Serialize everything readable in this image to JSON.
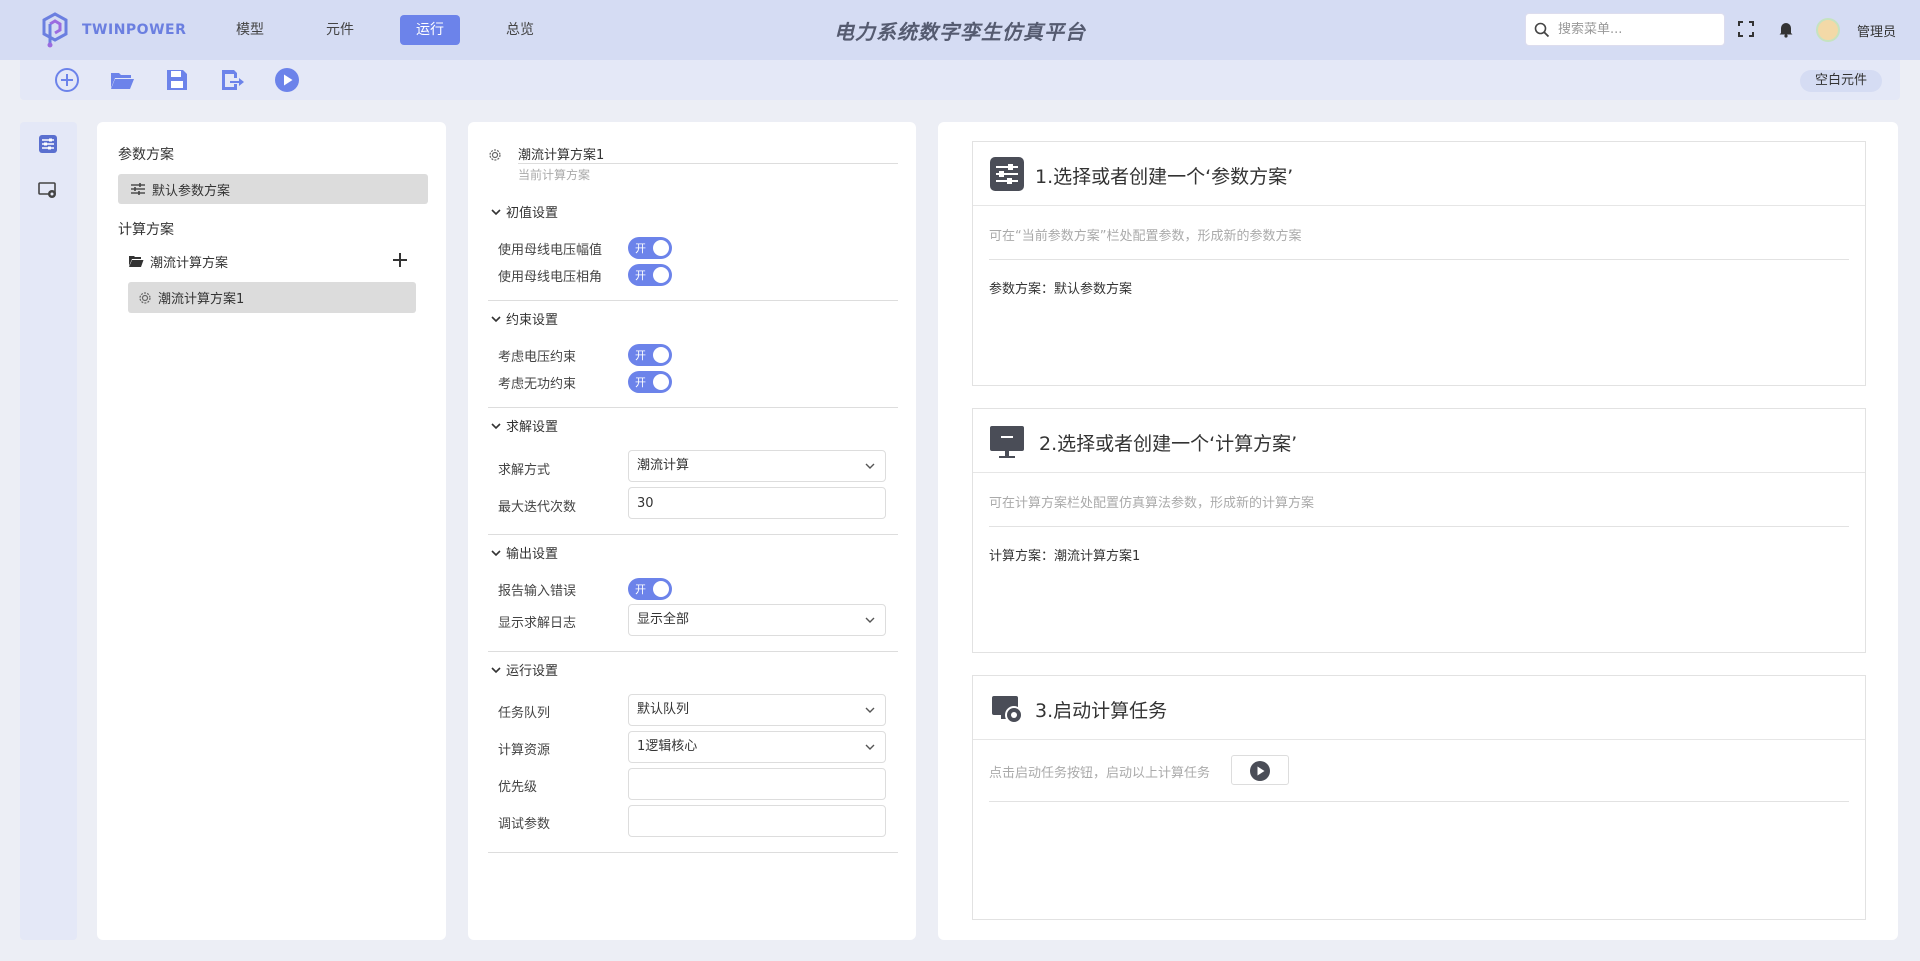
{
  "header": {
    "brand": "TWINPOWER",
    "app_title": "电力系统数字孪生仿真平台",
    "nav": [
      {
        "label": "模型",
        "active": false
      },
      {
        "label": "元件",
        "active": false
      },
      {
        "label": "运行",
        "active": true
      },
      {
        "label": "总览",
        "active": false
      }
    ],
    "search_placeholder": "搜索菜单...",
    "username": "管理员",
    "accent_color": "#6c83ea"
  },
  "toolbar": {
    "buttons": [
      "add-circle-icon",
      "folder-open-icon",
      "save-icon",
      "export-icon",
      "play-icon"
    ],
    "badge": "空白元件"
  },
  "rail": {
    "items": [
      "sliders-icon",
      "monitor-gear-icon"
    ]
  },
  "scheme_panel": {
    "param_section": "参数方案",
    "param_item": "默认参数方案",
    "calc_section": "计算方案",
    "calc_folder": "潮流计算方案",
    "calc_item": "潮流计算方案1"
  },
  "settings_panel": {
    "name": "潮流计算方案1",
    "subtitle": "当前计算方案",
    "groups": {
      "initial": {
        "title": "初值设置",
        "rows": [
          {
            "label": "使用母线电压幅值",
            "toggle": "开"
          },
          {
            "label": "使用母线电压相角",
            "toggle": "开"
          }
        ]
      },
      "constraint": {
        "title": "约束设置",
        "rows": [
          {
            "label": "考虑电压约束",
            "toggle": "开"
          },
          {
            "label": "考虑无功约束",
            "toggle": "开"
          }
        ]
      },
      "solve": {
        "title": "求解设置",
        "method_label": "求解方式",
        "method_value": "潮流计算",
        "iter_label": "最大迭代次数",
        "iter_value": "30"
      },
      "output": {
        "title": "输出设置",
        "report_label": "报告输入错误",
        "report_toggle": "开",
        "log_label": "显示求解日志",
        "log_value": "显示全部"
      },
      "run": {
        "title": "运行设置",
        "queue_label": "任务队列",
        "queue_value": "默认队列",
        "resource_label": "计算资源",
        "resource_value": "1逻辑核心",
        "priority_label": "优先级",
        "priority_value": "",
        "debug_label": "调试参数",
        "debug_value": ""
      }
    }
  },
  "steps": [
    {
      "title": "1.选择或者创建一个‘参数方案’",
      "hint": "可在“当前参数方案”栏处配置参数，形成新的参数方案",
      "value": "参数方案：默认参数方案"
    },
    {
      "title": "2.选择或者创建一个‘计算方案’",
      "hint": "可在计算方案栏处配置仿真算法参数，形成新的计算方案",
      "value": "计算方案：潮流计算方案1"
    },
    {
      "title": "3.启动计算任务",
      "hint": "点击启动任务按钮，启动以上计算任务"
    }
  ]
}
